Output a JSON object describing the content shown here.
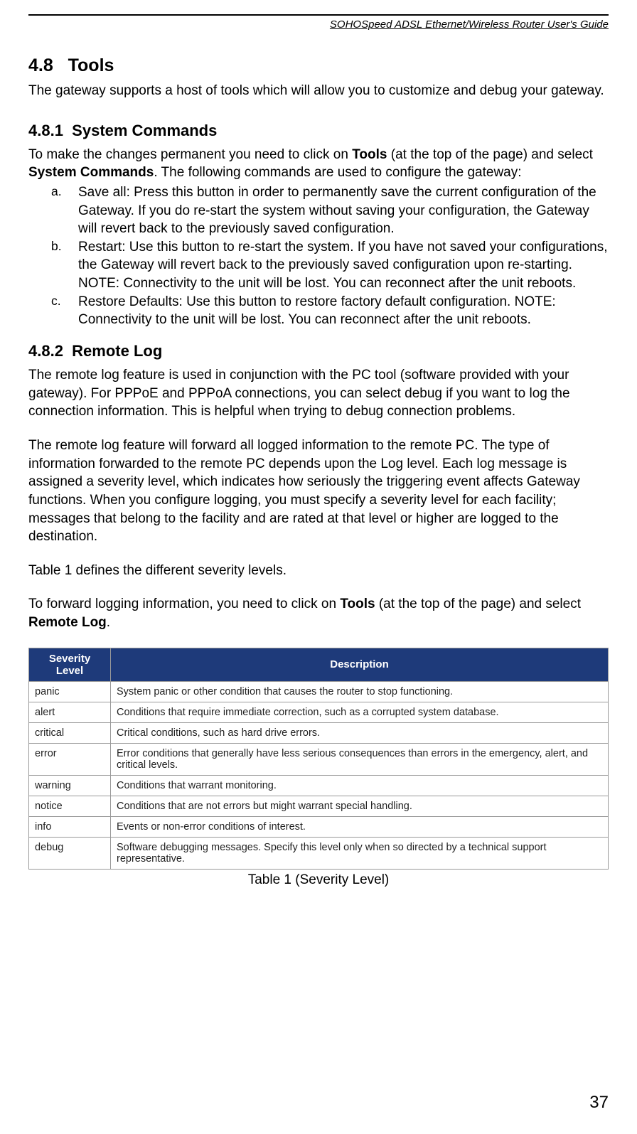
{
  "header": {
    "title": "SOHOSpeed ADSL Ethernet/Wireless Router User's Guide"
  },
  "section": {
    "number": "4.8",
    "title": "Tools",
    "intro": "The gateway supports a host of tools which will allow you to customize and debug your gateway."
  },
  "subsection1": {
    "number": "4.8.1",
    "title": "System Commands",
    "intro_pre": "To make the changes permanent you need to click on ",
    "intro_bold1": "Tools",
    "intro_mid": " (at the top of the page) and select ",
    "intro_bold2": "System Commands",
    "intro_post": ". The following commands are used to configure the gateway:",
    "items": [
      {
        "marker": "a.",
        "text": "Save all: Press this button in order to permanently save the current configuration of the Gateway. If you do re-start the system without saving your configuration, the Gateway will revert back to the previously saved configuration."
      },
      {
        "marker": "b.",
        "text": "Restart: Use this button to re-start the system. If you have not saved your configurations, the Gateway will revert back to the previously saved configuration upon re-starting. NOTE: Connectivity to the unit will be lost. You can reconnect after the unit reboots."
      },
      {
        "marker": "c.",
        "text": "Restore Defaults: Use this button to restore factory default configuration. NOTE: Connectivity to the unit will be lost. You can reconnect after the unit reboots."
      }
    ]
  },
  "subsection2": {
    "number": "4.8.2",
    "title": "Remote Log",
    "para1": "The remote log feature is used in conjunction with the PC tool (software provided with your gateway). For PPPoE and PPPoA connections, you can select debug if you want to log the connection information. This is helpful when trying to debug connection problems.",
    "para2": "The remote log feature will forward all logged information to the remote PC. The type of information forwarded to the remote PC depends upon the Log level. Each log message is assigned a severity level, which indicates how seriously the triggering event affects Gateway functions. When you configure logging, you must specify a severity level for each facility; messages that belong to the facility and are rated at that level or higher are logged to the destination.",
    "para3": "Table 1 defines the different severity levels.",
    "para4_pre": "To forward logging information, you need to click on ",
    "para4_bold1": "Tools",
    "para4_mid": " (at the top of the page) and select ",
    "para4_bold2": "Remote Log",
    "para4_post": "."
  },
  "table": {
    "headers": {
      "col1": "Severity Level",
      "col2": "Description"
    },
    "rows": [
      {
        "level": "panic",
        "desc": "System panic or other condition that causes the router to stop functioning."
      },
      {
        "level": "alert",
        "desc": "Conditions that require immediate correction, such as a corrupted system database."
      },
      {
        "level": "critical",
        "desc": "Critical conditions, such as hard drive errors."
      },
      {
        "level": "error",
        "desc": "Error conditions that generally have less serious consequences than errors in the emergency, alert, and critical levels."
      },
      {
        "level": "warning",
        "desc": "Conditions that warrant monitoring."
      },
      {
        "level": "notice",
        "desc": "Conditions that are not errors but might warrant special handling."
      },
      {
        "level": "info",
        "desc": "Events or non-error conditions of interest."
      },
      {
        "level": "debug",
        "desc": "Software debugging messages. Specify this level only when so directed by a technical support representative."
      }
    ],
    "caption": "Table 1 (Severity Level)"
  },
  "page_number": "37"
}
